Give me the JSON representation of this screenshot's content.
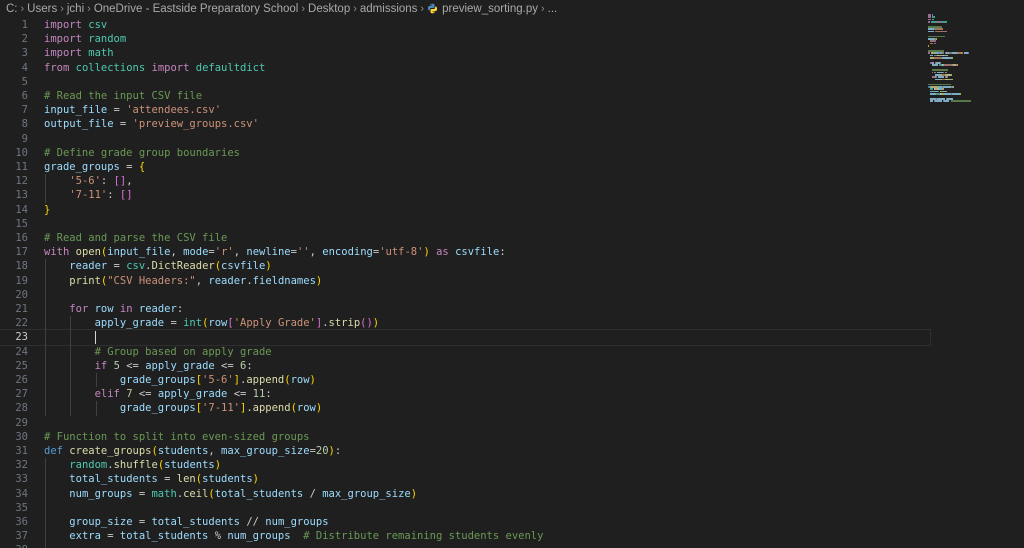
{
  "breadcrumb": {
    "items": [
      "C:",
      "Users",
      "jchi",
      "OneDrive - Eastside Preparatory School",
      "Desktop",
      "admissions"
    ],
    "file": "preview_sorting.py",
    "more": "..."
  },
  "icons": {
    "separator": "chevron-right-icon",
    "file": "python-file-icon"
  },
  "colors": {
    "background": "#1f1f1f",
    "keyword": "#c586c0",
    "builtin_keyword": "#569cd6",
    "function": "#dcdcaa",
    "string": "#ce9178",
    "number": "#b5cea8",
    "comment": "#6a9955",
    "variable": "#9cdcfe",
    "module": "#4ec9b0",
    "line_number": "#6e7681"
  },
  "editor": {
    "active_line": 23,
    "lines": [
      [
        [
          "kw",
          "import"
        ],
        [
          "t",
          " "
        ],
        [
          "mod",
          "csv"
        ]
      ],
      [
        [
          "kw",
          "import"
        ],
        [
          "t",
          " "
        ],
        [
          "mod",
          "random"
        ]
      ],
      [
        [
          "kw",
          "import"
        ],
        [
          "t",
          " "
        ],
        [
          "mod",
          "math"
        ]
      ],
      [
        [
          "kw",
          "from"
        ],
        [
          "t",
          " "
        ],
        [
          "mod",
          "collections"
        ],
        [
          "t",
          " "
        ],
        [
          "kw",
          "import"
        ],
        [
          "t",
          " "
        ],
        [
          "mod",
          "defaultdict"
        ]
      ],
      [],
      [
        [
          "cm",
          "# Read the input CSV file"
        ]
      ],
      [
        [
          "var",
          "input_file"
        ],
        [
          "t",
          " = "
        ],
        [
          "str",
          "'attendees.csv'"
        ]
      ],
      [
        [
          "var",
          "output_file"
        ],
        [
          "t",
          " = "
        ],
        [
          "str",
          "'preview_groups.csv'"
        ]
      ],
      [],
      [
        [
          "cm",
          "# Define grade group boundaries"
        ]
      ],
      [
        [
          "var",
          "grade_groups"
        ],
        [
          "t",
          " = "
        ],
        [
          "br1",
          "{"
        ]
      ],
      [
        [
          "t",
          "    "
        ],
        [
          "str",
          "'5-6'"
        ],
        [
          "t",
          ": "
        ],
        [
          "br2",
          "[]"
        ],
        [
          "t",
          ","
        ]
      ],
      [
        [
          "t",
          "    "
        ],
        [
          "str",
          "'7-11'"
        ],
        [
          "t",
          ": "
        ],
        [
          "br2",
          "[]"
        ]
      ],
      [
        [
          "br1",
          "}"
        ]
      ],
      [],
      [
        [
          "cm",
          "# Read and parse the CSV file"
        ]
      ],
      [
        [
          "kw",
          "with"
        ],
        [
          "t",
          " "
        ],
        [
          "fn",
          "open"
        ],
        [
          "br1",
          "("
        ],
        [
          "var",
          "input_file"
        ],
        [
          "t",
          ", "
        ],
        [
          "var",
          "mode"
        ],
        [
          "t",
          "="
        ],
        [
          "str",
          "'r'"
        ],
        [
          "t",
          ", "
        ],
        [
          "var",
          "newline"
        ],
        [
          "t",
          "="
        ],
        [
          "str",
          "''"
        ],
        [
          "t",
          ", "
        ],
        [
          "var",
          "encoding"
        ],
        [
          "t",
          "="
        ],
        [
          "str",
          "'utf-8'"
        ],
        [
          "br1",
          ")"
        ],
        [
          "t",
          " "
        ],
        [
          "kw",
          "as"
        ],
        [
          "t",
          " "
        ],
        [
          "var",
          "csvfile"
        ],
        [
          "t",
          ":"
        ]
      ],
      [
        [
          "t",
          "    "
        ],
        [
          "var",
          "reader"
        ],
        [
          "t",
          " = "
        ],
        [
          "mod",
          "csv"
        ],
        [
          "t",
          "."
        ],
        [
          "fn",
          "DictReader"
        ],
        [
          "br1",
          "("
        ],
        [
          "var",
          "csvfile"
        ],
        [
          "br1",
          ")"
        ]
      ],
      [
        [
          "t",
          "    "
        ],
        [
          "fn",
          "print"
        ],
        [
          "br1",
          "("
        ],
        [
          "str",
          "\"CSV Headers:\""
        ],
        [
          "t",
          ", "
        ],
        [
          "var",
          "reader"
        ],
        [
          "t",
          "."
        ],
        [
          "var",
          "fieldnames"
        ],
        [
          "br1",
          ")"
        ]
      ],
      [],
      [
        [
          "t",
          "    "
        ],
        [
          "kw",
          "for"
        ],
        [
          "t",
          " "
        ],
        [
          "var",
          "row"
        ],
        [
          "t",
          " "
        ],
        [
          "kw",
          "in"
        ],
        [
          "t",
          " "
        ],
        [
          "var",
          "reader"
        ],
        [
          "t",
          ":"
        ]
      ],
      [
        [
          "t",
          "        "
        ],
        [
          "var",
          "apply_grade"
        ],
        [
          "t",
          " = "
        ],
        [
          "mod",
          "int"
        ],
        [
          "br1",
          "("
        ],
        [
          "var",
          "row"
        ],
        [
          "br2",
          "["
        ],
        [
          "str",
          "'Apply Grade'"
        ],
        [
          "br2",
          "]"
        ],
        [
          "t",
          "."
        ],
        [
          "fn",
          "strip"
        ],
        [
          "br2",
          "()"
        ],
        [
          "br1",
          ")"
        ]
      ],
      [],
      [
        [
          "t",
          "        "
        ],
        [
          "cm",
          "# Group based on apply grade"
        ]
      ],
      [
        [
          "t",
          "        "
        ],
        [
          "kw",
          "if"
        ],
        [
          "t",
          " "
        ],
        [
          "num",
          "5"
        ],
        [
          "t",
          " <= "
        ],
        [
          "var",
          "apply_grade"
        ],
        [
          "t",
          " <= "
        ],
        [
          "num",
          "6"
        ],
        [
          "t",
          ":"
        ]
      ],
      [
        [
          "t",
          "            "
        ],
        [
          "var",
          "grade_groups"
        ],
        [
          "br1",
          "["
        ],
        [
          "str",
          "'5-6'"
        ],
        [
          "br1",
          "]"
        ],
        [
          "t",
          "."
        ],
        [
          "fn",
          "append"
        ],
        [
          "br1",
          "("
        ],
        [
          "var",
          "row"
        ],
        [
          "br1",
          ")"
        ]
      ],
      [
        [
          "t",
          "        "
        ],
        [
          "kw",
          "elif"
        ],
        [
          "t",
          " "
        ],
        [
          "num",
          "7"
        ],
        [
          "t",
          " <= "
        ],
        [
          "var",
          "apply_grade"
        ],
        [
          "t",
          " <= "
        ],
        [
          "num",
          "11"
        ],
        [
          "t",
          ":"
        ]
      ],
      [
        [
          "t",
          "            "
        ],
        [
          "var",
          "grade_groups"
        ],
        [
          "br1",
          "["
        ],
        [
          "str",
          "'7-11'"
        ],
        [
          "br1",
          "]"
        ],
        [
          "t",
          "."
        ],
        [
          "fn",
          "append"
        ],
        [
          "br1",
          "("
        ],
        [
          "var",
          "row"
        ],
        [
          "br1",
          ")"
        ]
      ],
      [],
      [
        [
          "cm",
          "# Function to split into even-sized groups"
        ]
      ],
      [
        [
          "kb",
          "def"
        ],
        [
          "t",
          " "
        ],
        [
          "fn",
          "create_groups"
        ],
        [
          "br1",
          "("
        ],
        [
          "var",
          "students"
        ],
        [
          "t",
          ", "
        ],
        [
          "var",
          "max_group_size"
        ],
        [
          "t",
          "="
        ],
        [
          "num",
          "20"
        ],
        [
          "br1",
          ")"
        ],
        [
          "t",
          ":"
        ]
      ],
      [
        [
          "t",
          "    "
        ],
        [
          "mod",
          "random"
        ],
        [
          "t",
          "."
        ],
        [
          "fn",
          "shuffle"
        ],
        [
          "br1",
          "("
        ],
        [
          "var",
          "students"
        ],
        [
          "br1",
          ")"
        ]
      ],
      [
        [
          "t",
          "    "
        ],
        [
          "var",
          "total_students"
        ],
        [
          "t",
          " = "
        ],
        [
          "fn",
          "len"
        ],
        [
          "br1",
          "("
        ],
        [
          "var",
          "students"
        ],
        [
          "br1",
          ")"
        ]
      ],
      [
        [
          "t",
          "    "
        ],
        [
          "var",
          "num_groups"
        ],
        [
          "t",
          " = "
        ],
        [
          "mod",
          "math"
        ],
        [
          "t",
          "."
        ],
        [
          "fn",
          "ceil"
        ],
        [
          "br1",
          "("
        ],
        [
          "var",
          "total_students"
        ],
        [
          "t",
          " / "
        ],
        [
          "var",
          "max_group_size"
        ],
        [
          "br1",
          ")"
        ]
      ],
      [],
      [
        [
          "t",
          "    "
        ],
        [
          "var",
          "group_size"
        ],
        [
          "t",
          " = "
        ],
        [
          "var",
          "total_students"
        ],
        [
          "t",
          " // "
        ],
        [
          "var",
          "num_groups"
        ]
      ],
      [
        [
          "t",
          "    "
        ],
        [
          "var",
          "extra"
        ],
        [
          "t",
          " = "
        ],
        [
          "var",
          "total_students"
        ],
        [
          "t",
          " % "
        ],
        [
          "var",
          "num_groups"
        ],
        [
          "t",
          "  "
        ],
        [
          "cm",
          "# Distribute remaining students evenly"
        ]
      ],
      []
    ]
  }
}
